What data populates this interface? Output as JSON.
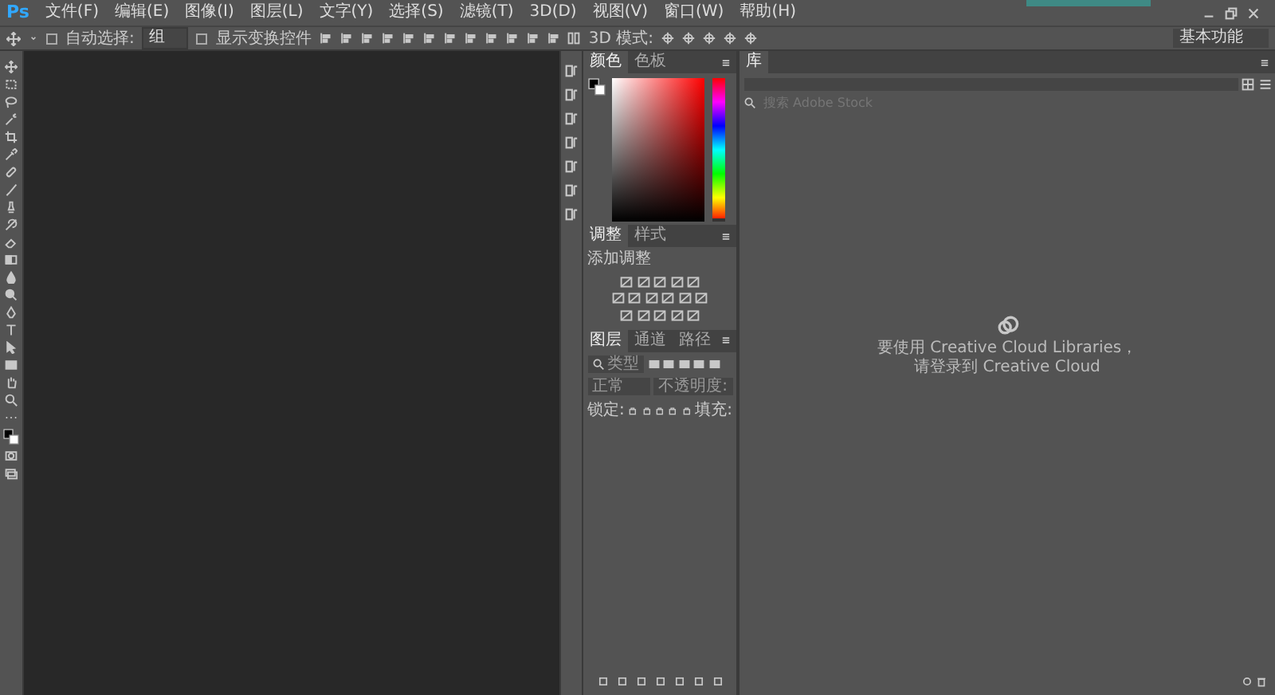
{
  "app_logo": "Ps",
  "menu": [
    "文件(F)",
    "编辑(E)",
    "图像(I)",
    "图层(L)",
    "文字(Y)",
    "选择(S)",
    "滤镜(T)",
    "3D(D)",
    "视图(V)",
    "窗口(W)",
    "帮助(H)"
  ],
  "options": {
    "auto_select_label": "自动选择:",
    "auto_select_checked": false,
    "target": "组",
    "show_transform_label": "显示变换控件",
    "show_transform_checked": false,
    "mode_3d_label": "3D 模式:"
  },
  "workspace": "基本功能",
  "color_panel": {
    "tabs": [
      {
        "label": "颜色",
        "selected": true
      },
      {
        "label": "色板",
        "selected": false
      }
    ],
    "hue_slider": {
      "level": 0
    }
  },
  "adjustments_panel": {
    "tabs": [
      {
        "label": "调整",
        "selected": true
      },
      {
        "label": "样式",
        "selected": false
      }
    ],
    "heading": "添加调整"
  },
  "layers_panel": {
    "tabs": [
      {
        "label": "图层",
        "selected": true
      },
      {
        "label": "通道",
        "selected": false
      },
      {
        "label": "路径",
        "selected": false
      }
    ],
    "filter": "类型",
    "blend_mode": "正常",
    "opacity_label": "不透明度:",
    "lock_label": "锁定:",
    "fill_label": "填充:"
  },
  "libraries_panel": {
    "tabs": [
      {
        "label": "库",
        "selected": true
      }
    ],
    "search_placeholder": "搜索 Adobe Stock",
    "message_lines": [
      "要使用 Creative Cloud Libraries，",
      "请登录到 Creative Cloud"
    ]
  }
}
